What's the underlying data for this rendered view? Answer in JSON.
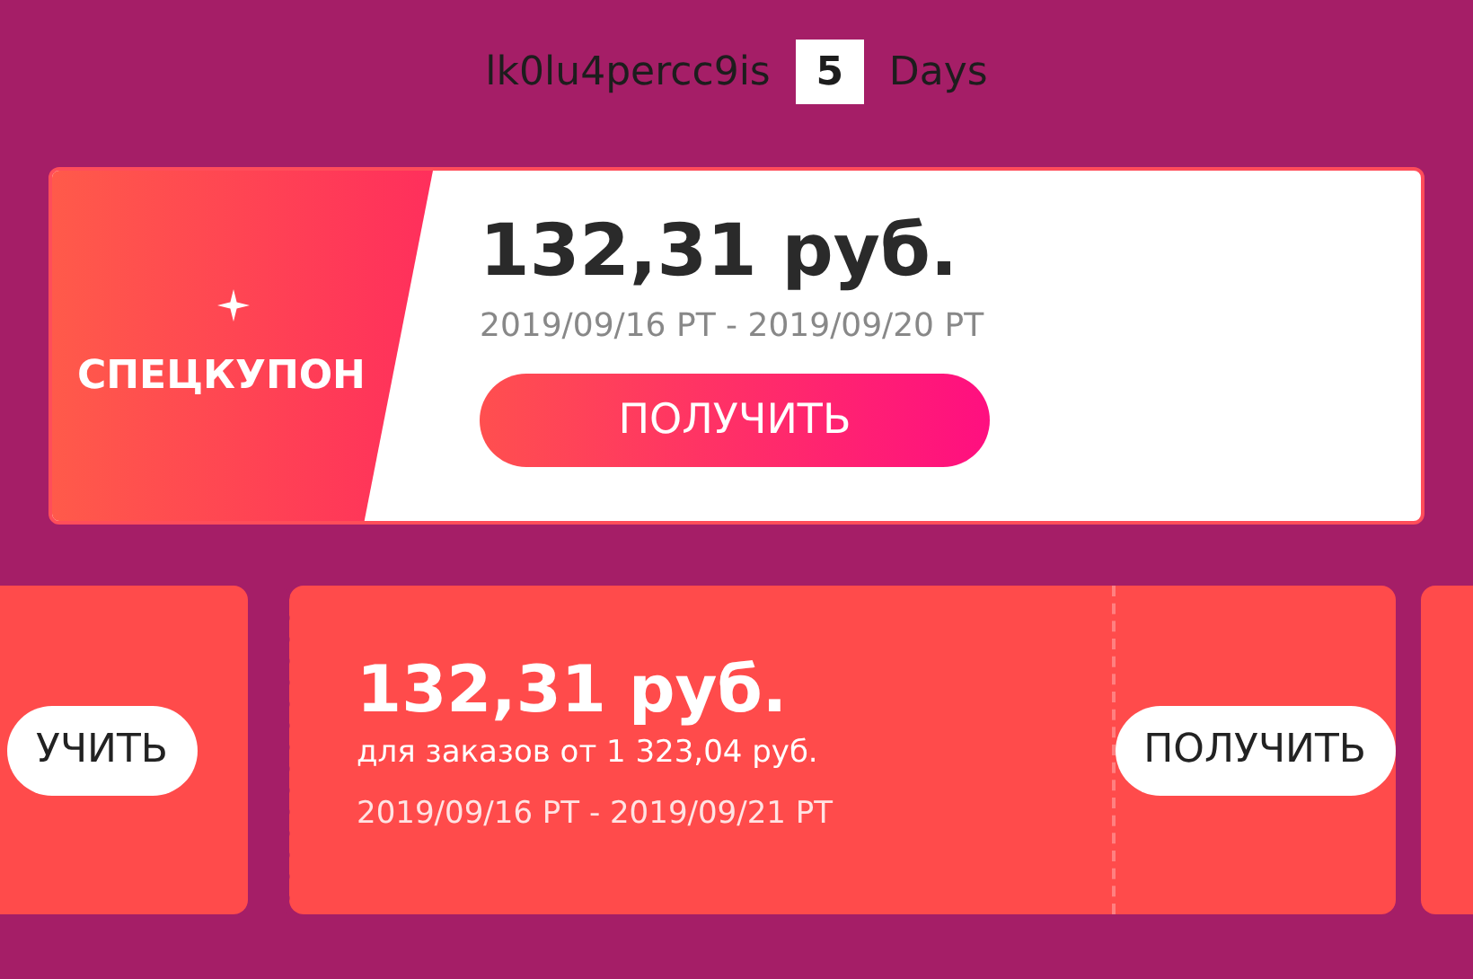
{
  "header": {
    "code": "lk0lu4percc9is",
    "days": "5",
    "days_label": "Days"
  },
  "special_coupon": {
    "label": "СПЕЦКУПОН",
    "amount": "132,31 руб.",
    "validity": "2019/09/16 PT - 2019/09/20 PT",
    "button": "ПОЛУЧИТЬ"
  },
  "coupons": [
    {
      "kind": "partial",
      "button": "УЧИТЬ"
    },
    {
      "kind": "full",
      "amount": "132,31 руб.",
      "condition": "для заказов от 1 323,04 руб.",
      "validity": "2019/09/16 PT - 2019/09/21 PT",
      "button": "ПОЛУЧИТЬ"
    },
    {
      "kind": "edge"
    }
  ]
}
